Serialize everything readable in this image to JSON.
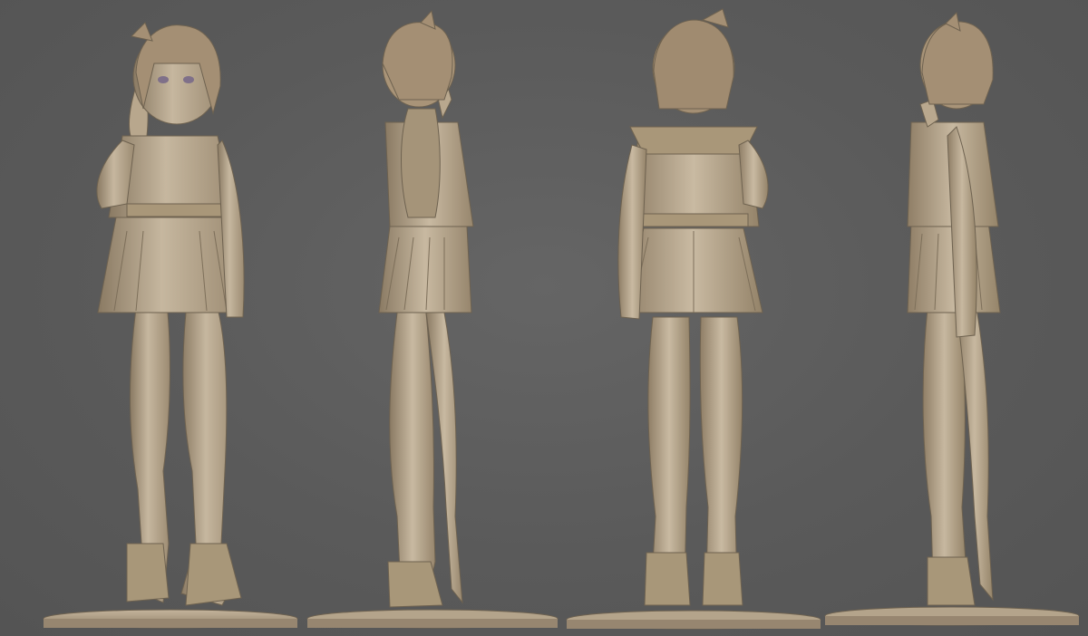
{
  "viewport": {
    "background_color": "#5b5b5b",
    "material_color": "#b3a28a",
    "shadow_color": "#8a7a63",
    "highlight_color": "#cdbfa9"
  },
  "views": [
    {
      "name": "front"
    },
    {
      "name": "left-side"
    },
    {
      "name": "back"
    },
    {
      "name": "right-side"
    }
  ]
}
